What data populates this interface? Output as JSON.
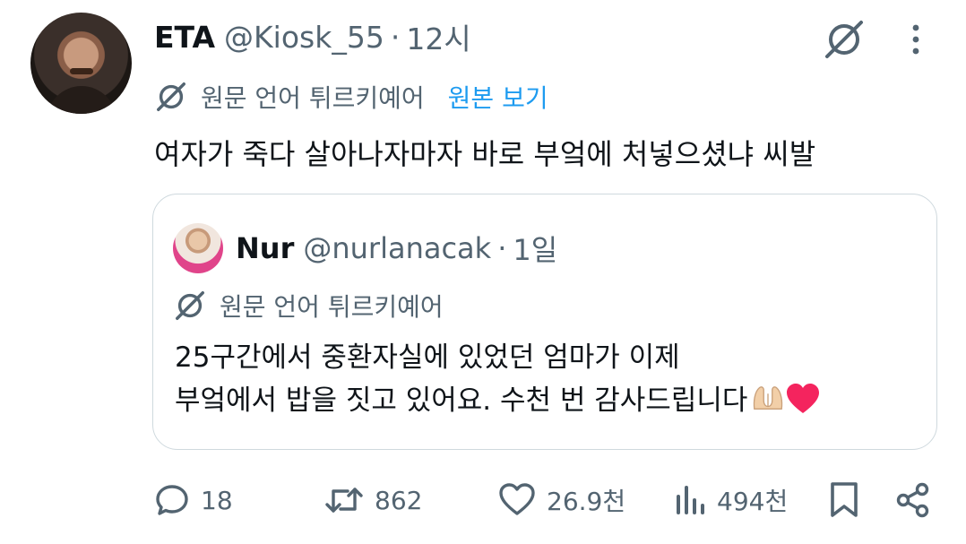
{
  "tweet": {
    "name": "ETA",
    "handle": "@Kiosk_55",
    "dot": "·",
    "time": "12시",
    "translation_note": "원문 언어 튀르키예어",
    "show_original": "원본 보기",
    "text": "여자가 죽다 살아나자마자 바로 부엌에 처넣으셨냐 씨발"
  },
  "quoted": {
    "name": "Nur",
    "handle": "@nurlanacak",
    "dot": "·",
    "time": "1일",
    "translation_note": "원문 언어 튀르키예어",
    "line1": "25구간에서 중환자실에 있었던 엄마가 이제",
    "line2": "부엌에서 밥을 짓고 있어요. 수천 번 감사드립니다"
  },
  "actions": {
    "replies": "18",
    "retweets": "862",
    "likes": "26.9천",
    "views": "494천"
  },
  "icons": {
    "grok": "grok-icon",
    "more": "more-icon",
    "translate": "translate-icon",
    "reply": "reply-icon",
    "retweet": "retweet-icon",
    "like": "heart-icon",
    "views": "views-icon",
    "bookmark": "bookmark-icon",
    "share": "share-icon",
    "emoji1": "praying-hands-emoji",
    "emoji2": "red-heart-emoji"
  },
  "colors": {
    "text": "#0f1419",
    "secondary": "#536471",
    "link": "#1d9bf0",
    "border": "#cfd9de",
    "heart": "#f4245e"
  }
}
